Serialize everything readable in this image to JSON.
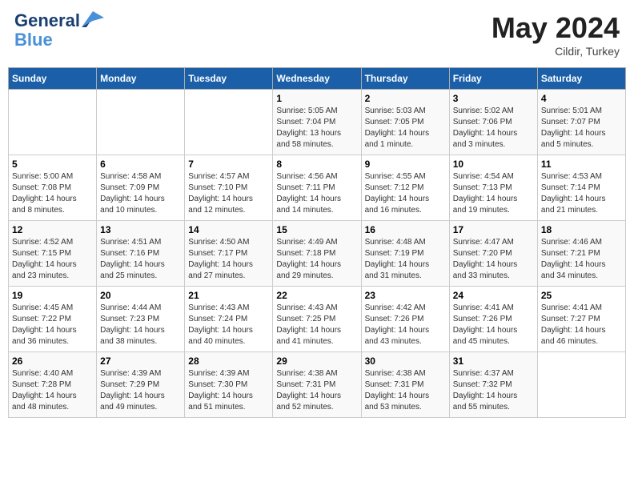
{
  "header": {
    "logo_line1": "General",
    "logo_line2": "Blue",
    "month": "May 2024",
    "location": "Cildir, Turkey"
  },
  "weekdays": [
    "Sunday",
    "Monday",
    "Tuesday",
    "Wednesday",
    "Thursday",
    "Friday",
    "Saturday"
  ],
  "weeks": [
    [
      {
        "day": "",
        "info": ""
      },
      {
        "day": "",
        "info": ""
      },
      {
        "day": "",
        "info": ""
      },
      {
        "day": "1",
        "info": "Sunrise: 5:05 AM\nSunset: 7:04 PM\nDaylight: 13 hours\nand 58 minutes."
      },
      {
        "day": "2",
        "info": "Sunrise: 5:03 AM\nSunset: 7:05 PM\nDaylight: 14 hours\nand 1 minute."
      },
      {
        "day": "3",
        "info": "Sunrise: 5:02 AM\nSunset: 7:06 PM\nDaylight: 14 hours\nand 3 minutes."
      },
      {
        "day": "4",
        "info": "Sunrise: 5:01 AM\nSunset: 7:07 PM\nDaylight: 14 hours\nand 5 minutes."
      }
    ],
    [
      {
        "day": "5",
        "info": "Sunrise: 5:00 AM\nSunset: 7:08 PM\nDaylight: 14 hours\nand 8 minutes."
      },
      {
        "day": "6",
        "info": "Sunrise: 4:58 AM\nSunset: 7:09 PM\nDaylight: 14 hours\nand 10 minutes."
      },
      {
        "day": "7",
        "info": "Sunrise: 4:57 AM\nSunset: 7:10 PM\nDaylight: 14 hours\nand 12 minutes."
      },
      {
        "day": "8",
        "info": "Sunrise: 4:56 AM\nSunset: 7:11 PM\nDaylight: 14 hours\nand 14 minutes."
      },
      {
        "day": "9",
        "info": "Sunrise: 4:55 AM\nSunset: 7:12 PM\nDaylight: 14 hours\nand 16 minutes."
      },
      {
        "day": "10",
        "info": "Sunrise: 4:54 AM\nSunset: 7:13 PM\nDaylight: 14 hours\nand 19 minutes."
      },
      {
        "day": "11",
        "info": "Sunrise: 4:53 AM\nSunset: 7:14 PM\nDaylight: 14 hours\nand 21 minutes."
      }
    ],
    [
      {
        "day": "12",
        "info": "Sunrise: 4:52 AM\nSunset: 7:15 PM\nDaylight: 14 hours\nand 23 minutes."
      },
      {
        "day": "13",
        "info": "Sunrise: 4:51 AM\nSunset: 7:16 PM\nDaylight: 14 hours\nand 25 minutes."
      },
      {
        "day": "14",
        "info": "Sunrise: 4:50 AM\nSunset: 7:17 PM\nDaylight: 14 hours\nand 27 minutes."
      },
      {
        "day": "15",
        "info": "Sunrise: 4:49 AM\nSunset: 7:18 PM\nDaylight: 14 hours\nand 29 minutes."
      },
      {
        "day": "16",
        "info": "Sunrise: 4:48 AM\nSunset: 7:19 PM\nDaylight: 14 hours\nand 31 minutes."
      },
      {
        "day": "17",
        "info": "Sunrise: 4:47 AM\nSunset: 7:20 PM\nDaylight: 14 hours\nand 33 minutes."
      },
      {
        "day": "18",
        "info": "Sunrise: 4:46 AM\nSunset: 7:21 PM\nDaylight: 14 hours\nand 34 minutes."
      }
    ],
    [
      {
        "day": "19",
        "info": "Sunrise: 4:45 AM\nSunset: 7:22 PM\nDaylight: 14 hours\nand 36 minutes."
      },
      {
        "day": "20",
        "info": "Sunrise: 4:44 AM\nSunset: 7:23 PM\nDaylight: 14 hours\nand 38 minutes."
      },
      {
        "day": "21",
        "info": "Sunrise: 4:43 AM\nSunset: 7:24 PM\nDaylight: 14 hours\nand 40 minutes."
      },
      {
        "day": "22",
        "info": "Sunrise: 4:43 AM\nSunset: 7:25 PM\nDaylight: 14 hours\nand 41 minutes."
      },
      {
        "day": "23",
        "info": "Sunrise: 4:42 AM\nSunset: 7:26 PM\nDaylight: 14 hours\nand 43 minutes."
      },
      {
        "day": "24",
        "info": "Sunrise: 4:41 AM\nSunset: 7:26 PM\nDaylight: 14 hours\nand 45 minutes."
      },
      {
        "day": "25",
        "info": "Sunrise: 4:41 AM\nSunset: 7:27 PM\nDaylight: 14 hours\nand 46 minutes."
      }
    ],
    [
      {
        "day": "26",
        "info": "Sunrise: 4:40 AM\nSunset: 7:28 PM\nDaylight: 14 hours\nand 48 minutes."
      },
      {
        "day": "27",
        "info": "Sunrise: 4:39 AM\nSunset: 7:29 PM\nDaylight: 14 hours\nand 49 minutes."
      },
      {
        "day": "28",
        "info": "Sunrise: 4:39 AM\nSunset: 7:30 PM\nDaylight: 14 hours\nand 51 minutes."
      },
      {
        "day": "29",
        "info": "Sunrise: 4:38 AM\nSunset: 7:31 PM\nDaylight: 14 hours\nand 52 minutes."
      },
      {
        "day": "30",
        "info": "Sunrise: 4:38 AM\nSunset: 7:31 PM\nDaylight: 14 hours\nand 53 minutes."
      },
      {
        "day": "31",
        "info": "Sunrise: 4:37 AM\nSunset: 7:32 PM\nDaylight: 14 hours\nand 55 minutes."
      },
      {
        "day": "",
        "info": ""
      }
    ]
  ]
}
